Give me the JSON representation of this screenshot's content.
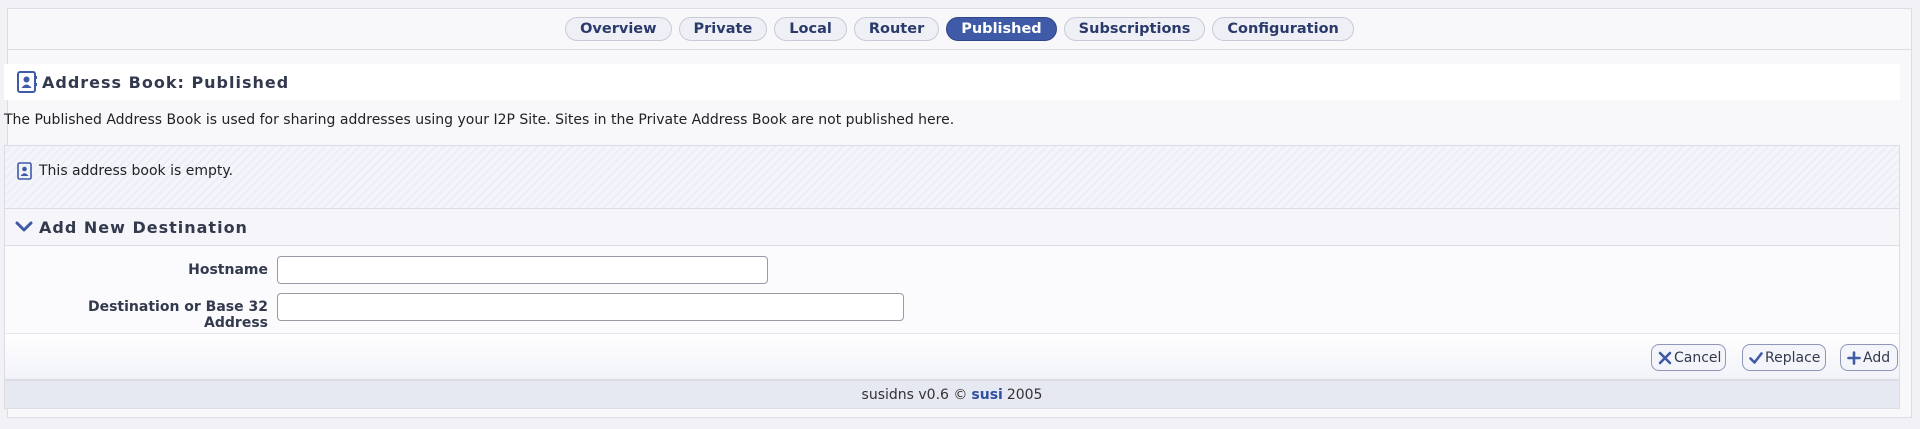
{
  "nav": {
    "tabs": [
      "Overview",
      "Private",
      "Local",
      "Router",
      "Published",
      "Subscriptions",
      "Configuration"
    ],
    "active": "Published"
  },
  "header": {
    "title": "Address Book: Published",
    "icon": "address-book-icon"
  },
  "description": "The Published Address Book is used for sharing addresses using your I2P Site. Sites in the Private Address Book are not published here.",
  "empty_message": "This address book is empty.",
  "add_section": {
    "title": "Add New Destination",
    "hostname_label": "Hostname",
    "hostname_value": "",
    "destination_label": "Destination or Base 32 Address",
    "destination_value": ""
  },
  "buttons": {
    "cancel": "Cancel",
    "replace": "Replace",
    "add": "Add"
  },
  "footer": {
    "prefix": "susidns v0.6 ©",
    "link": "susi",
    "year": "2005"
  },
  "colors": {
    "accent": "#3f5aa6",
    "link": "#2f4f9f"
  }
}
